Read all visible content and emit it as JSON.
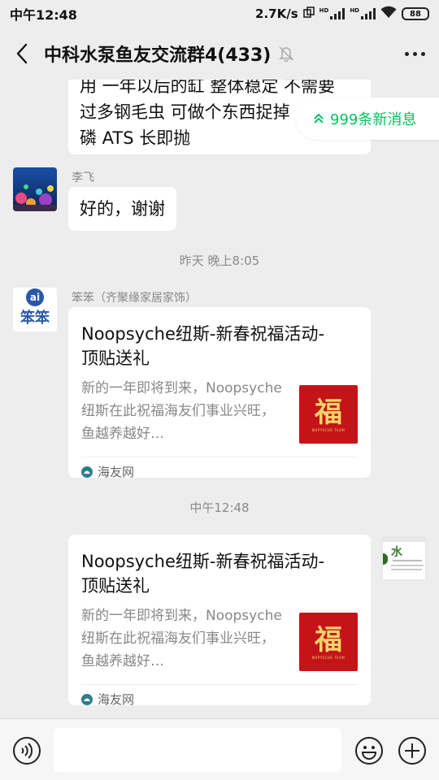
{
  "status_bar": {
    "time": "中午12:48",
    "net_speed": "2.7K/s",
    "sim1_label": "HD",
    "sim2_label": "HD",
    "battery": "88"
  },
  "header": {
    "title": "中科水泵鱼友交流群4(433)",
    "icons": {
      "back": "back-arrow-icon",
      "mute": "mute-bell-icon",
      "more": "more-dots-icon"
    }
  },
  "new_messages": {
    "label": "999条新消息",
    "icon": "double-chevron-up-icon"
  },
  "messages": [
    {
      "type": "text",
      "lines": [
        "用 一年以后的缸 整体稳定 不需要",
        "过多钢毛虫 可做个东西捉掉",
        "磷 ATS 长即抛"
      ]
    },
    {
      "type": "text",
      "sender": "李飞",
      "text": "好的，谢谢"
    },
    {
      "type": "time",
      "text": "昨天 晚上8:05"
    },
    {
      "type": "card",
      "sender": "笨笨（齐聚缘家居家饰）",
      "avatar_text": "ai",
      "avatar_sub": "笨笨",
      "title": "Noopsyche纽斯-新春祝福活动-顶贴送礼",
      "desc": "新的一年即将到来，Noopsyche纽斯在此祝福海友们事业兴旺，鱼越养越好…",
      "thumb_char": "福",
      "thumb_sub": "NOPYSCHE TEAM",
      "source": "海友网"
    },
    {
      "type": "time",
      "text": "中午12:48"
    },
    {
      "type": "card",
      "title": "Noopsyche纽斯-新春祝福活动-顶贴送礼",
      "desc": "新的一年即将到来，Noopsyche纽斯在此祝福海友们事业兴旺，鱼越养越好…",
      "thumb_char": "福",
      "thumb_sub": "NOPYSCHE TEAM",
      "source": "海友网",
      "self_avatar_char": "水"
    }
  ],
  "input_bar": {
    "value": "",
    "icons": {
      "voice": "voice-icon",
      "emoji": "emoji-icon",
      "add": "plus-circle-icon"
    }
  },
  "colors": {
    "accent": "#07c160",
    "background": "#ededed",
    "bubble": "#ffffff",
    "thumb_red": "#c4141a"
  }
}
